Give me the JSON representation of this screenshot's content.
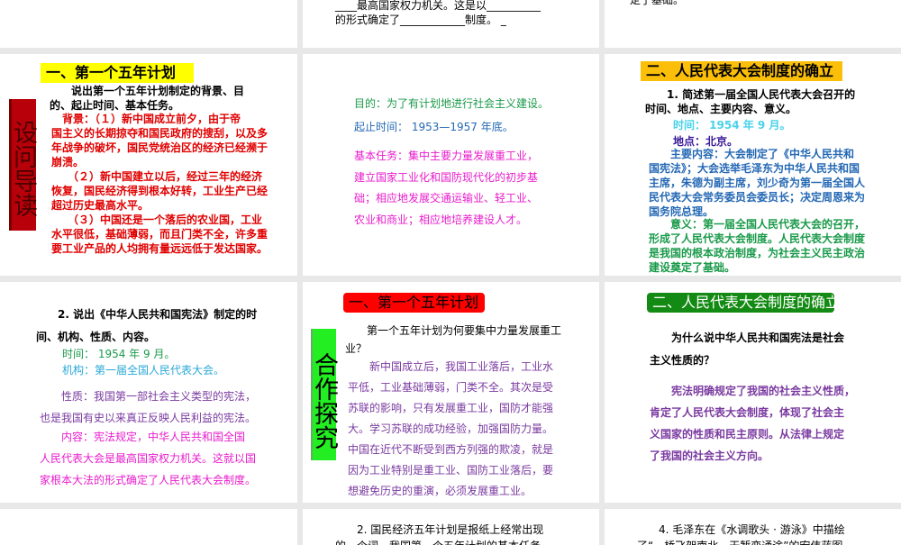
{
  "slides": {
    "r1c2": {
      "lines": [
        "____最高国家权力机关。这是以__________",
        "的形式确定了____________制度。 _"
      ]
    },
    "r1c3": {
      "lines": [
        "定了基础。"
      ]
    },
    "r2c1": {
      "title": "一、第一个五年计划",
      "side_label": "设问导读",
      "question": [
        "　　说出第一个五年计划制定的背景、目",
        "的、起止时间、基本任务。"
      ],
      "answer": [
        "　背景：（１）新中国成立前夕，由于帝",
        "国主义的长期掠夺和国民政府的搜刮，以及多",
        "年战争的破坏，国民党统治区的经济已经濒于",
        "崩溃。",
        "　　（２）新中国建立以后，经过三年的经济",
        "恢复，国民经济得到根本好转，工业生产已经",
        "超过历史最高水平。",
        "　　（３）中国还是一个落后的农业国，工业",
        "水平很低，基础薄弱，而且门类不全，许多重",
        "要工业产品的人均拥有量远远低于发达国家。"
      ]
    },
    "r2c2": {
      "purpose": [
        "目的：为了有计划地进行社会主义建设。"
      ],
      "period": [
        "起止时间： 1953—1957 年底。"
      ],
      "tasks": [
        "基本任务：集中主要力量发展重工业，",
        "建立国家工业化和国防现代化的初步基",
        "础；相应地发展交通运输业、轻工业、",
        "农业和商业；相应地培养建设人才。"
      ]
    },
    "r2c3": {
      "title": "二、人民代表大会制度的确立",
      "question": [
        "　　1. 简述第一届全国人民代表大会召开的",
        "时间、地点、主要内容、意义。"
      ],
      "time": [
        "时间： 1954 年 9 月。"
      ],
      "place": [
        "地点：北京。"
      ],
      "content": [
        "　　主要内容：大会制定了《中华人民共和",
        "国宪法》；大会选举毛泽东为中华人民共和国",
        "主席，朱德为副主席，刘少奇为第一届全国人",
        "民代表大会常务委员会委员长；决定周恩来为",
        "国务院总理。"
      ],
      "meaning": [
        "　　意义：第一届全国人民代表大会的召开，",
        "形成了人民代表大会制度。人民代表大会制度",
        "是我国的根本政治制度，为社会主义民主政治",
        "建设奠定了基础。"
      ]
    },
    "r3c1": {
      "question": [
        "　　2. 说出《中华人民共和国宪法》制定的时",
        "间、机构、性质、内容。"
      ],
      "time": [
        "时间： 1954 年 9 月。"
      ],
      "organ": [
        "机构：第一届全国人民代表大会。"
      ],
      "nature": [
        "　　性质：我国第一部社会主义类型的宪法，",
        "也是我国有史以来真正反映人民利益的宪法。"
      ],
      "content": [
        "　　内容：宪法规定，中华人民共和国全国",
        "人民代表大会是最高国家权力机关。这就以国",
        "家根本大法的形式确定了人民代表大会制度。"
      ]
    },
    "r3c2": {
      "title": "一、第一个五年计划",
      "side_label": "合作探究",
      "question": [
        "　　第一个五年计划为何要集中力量发展重工",
        "业？"
      ],
      "answer": [
        "　　新中国成立后，我国工业落后，工业水",
        "平低，工业基础薄弱，门类不全。其次是受",
        "苏联的影响，只有发展重工业，国防才能强",
        "大。学习苏联的成功经验，加强国防力量。",
        "中国在近代不断受到西方列强的欺凌，就是",
        "因为工业特别是重工业、国防工业落后，要",
        "想避免历史的重演，必须发展重工业。"
      ]
    },
    "r3c3": {
      "title": "二、人民代表大会制度的确立",
      "question": [
        "　　为什么说中华人民共和国宪法是社会",
        "主义性质的？"
      ],
      "answer": [
        "　　宪法明确规定了我国的社会主义性质，",
        "肯定了人民代表大会制度，体现了社会主",
        "义国家的性质和民主原则。从法律上规定",
        "了我国的社会主义方向。"
      ]
    },
    "r4c2": {
      "lines": [
        "　　2. 国民经济五年计划是报纸上经常出现",
        "的一个词。我国第一个五年计划的基本任务"
      ]
    },
    "r4c3": {
      "lines": [
        "　　4. 毛泽东在《水调歌头 · 游泳》中描绘",
        "了“一桥飞架南北，天堑变通途”的宏伟蓝图"
      ]
    }
  },
  "colors": {
    "red": "#e00000",
    "green": "#1a9a4a",
    "blue": "#2468b4",
    "magenta": "#e81ccc",
    "purple": "#7a3aa0",
    "cyan": "#48d2ea",
    "yellow": "#ffff00",
    "orange": "#fbbf0a",
    "title_green": "#138a13",
    "title_red": "#ff0000",
    "bar_green": "#22ee22",
    "bar_red": "#b8000a"
  }
}
